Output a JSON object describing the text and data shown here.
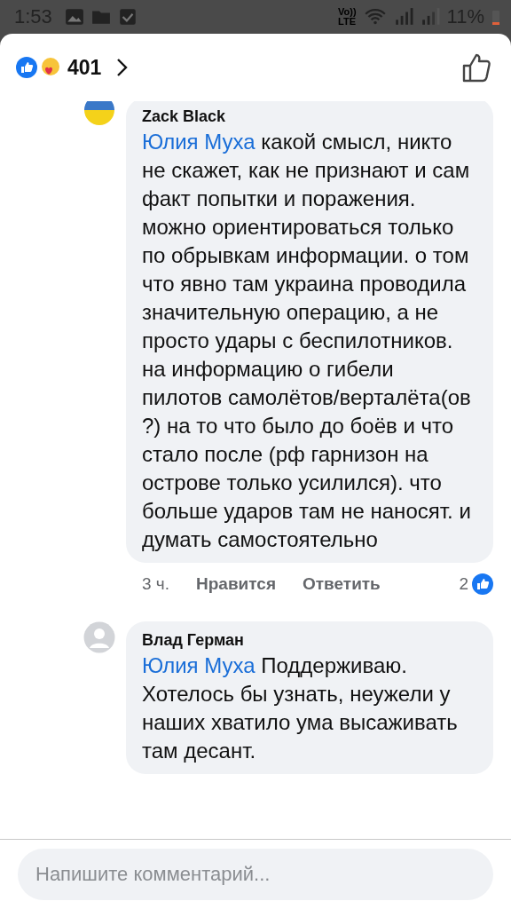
{
  "status_bar": {
    "time": "1:53",
    "volte_top": "Vo))",
    "volte_bottom": "LTE",
    "battery": "11%"
  },
  "reactions": {
    "count": "401"
  },
  "comments": [
    {
      "kind": "flag",
      "author": "Zack Black",
      "mention": "Юлия Муха",
      "text": "какой смысл, никто не скажет, как не признают и сам факт попытки и поражения. можно ориентироваться только по обрывкам информации. о том что явно там украина проводила значительную операцию, а не просто удары с беспилотников. на информацию о гибели пилотов самолётов/верталёта(ов ?) на то что было до боёв и что стало после (рф гарнизон на острове только усилился). что больше ударов там не наносят. и думать самостоятельно",
      "time": "3 ч.",
      "like_label": "Нравится",
      "reply_label": "Ответить",
      "likes": "2"
    },
    {
      "kind": "default",
      "author": "Влад Герман",
      "mention": "Юлия Муха",
      "text": "Поддерживаю. Хотелось бы узнать, неужели у наших хватило ума высаживать там десант."
    }
  ],
  "composer": {
    "placeholder": "Напишите комментарий..."
  }
}
